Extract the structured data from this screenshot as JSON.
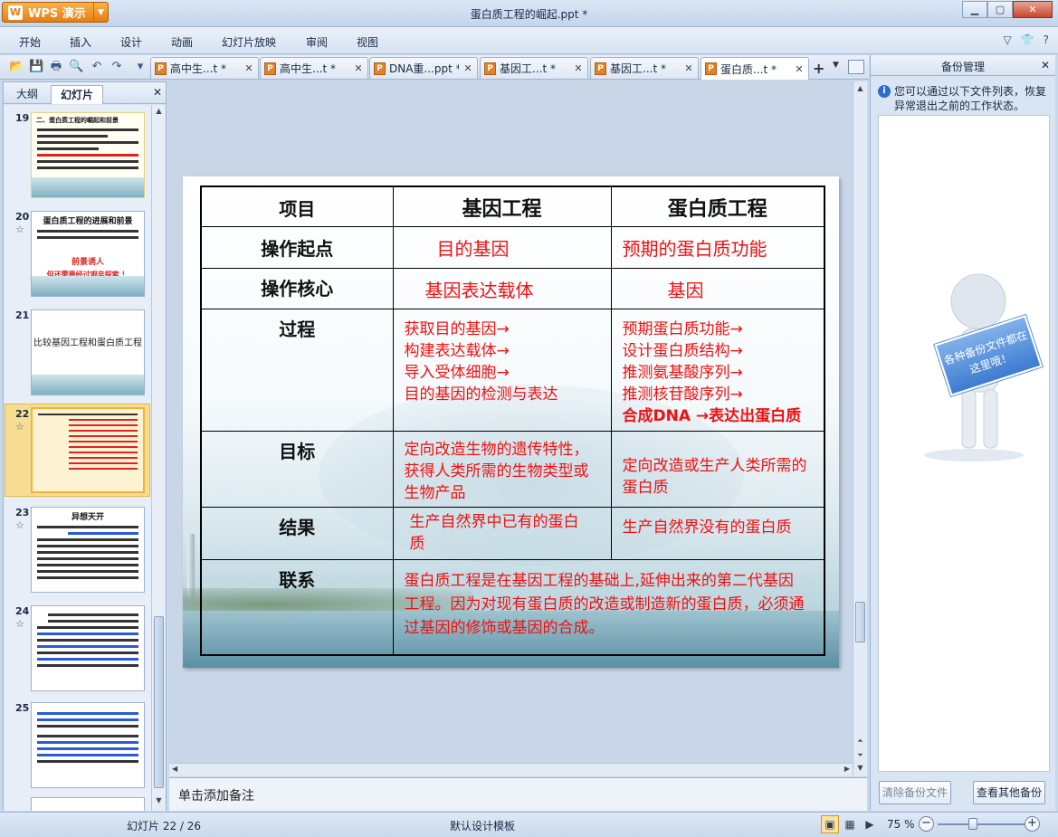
{
  "app": {
    "name": "WPS 演示",
    "logo": "W"
  },
  "window": {
    "title": "蛋白质工程的崛起.ppt *"
  },
  "menu": [
    "开始",
    "插入",
    "设计",
    "动画",
    "幻灯片放映",
    "审阅",
    "视图"
  ],
  "doc_tabs": [
    {
      "label": "高中生...t *",
      "active": false
    },
    {
      "label": "高中生...t *",
      "active": false
    },
    {
      "label": "DNA重...ppt *",
      "active": false
    },
    {
      "label": "基因工...t *",
      "active": false
    },
    {
      "label": "基因工...t *",
      "active": false
    },
    {
      "label": "蛋白质...t *",
      "active": true
    }
  ],
  "left_panel": {
    "tabs": [
      "大纲",
      "幻灯片"
    ],
    "active_tab": "幻灯片",
    "thumbnails": [
      {
        "number": "19",
        "title": "二、蛋白质工程的崛起和前景",
        "starred": false
      },
      {
        "number": "20",
        "title": "蛋白质工程的进展和前景",
        "subtitle": "前景诱人",
        "warning": "但还需要经过艰辛探索 ！",
        "starred": true
      },
      {
        "number": "21",
        "title": "比较基因工程和蛋白质工程",
        "starred": false
      },
      {
        "number": "22",
        "title": "",
        "starred": true,
        "selected": true
      },
      {
        "number": "23",
        "title": "异想天开",
        "starred": true
      },
      {
        "number": "24",
        "title": "",
        "starred": true
      },
      {
        "number": "25",
        "title": "",
        "starred": false
      }
    ]
  },
  "slide_table": {
    "headers": [
      "项目",
      "基因工程",
      "蛋白质工程"
    ],
    "rows": [
      {
        "label": "操作起点",
        "gene": "目的基因",
        "protein": "预期的蛋白质功能"
      },
      {
        "label": "操作核心",
        "gene": "基因表达载体",
        "protein": "基因"
      },
      {
        "label": "过程",
        "gene_lines": [
          "获取目的基因→",
          "构建表达载体→",
          "导入受体细胞→",
          "目的基因的检测与表达"
        ],
        "protein_lines": [
          "预期蛋白质功能→",
          "设计蛋白质结构→",
          "推测氨基酸序列→",
          "推测核苷酸序列→",
          "合成DNA →表达出蛋白质"
        ]
      },
      {
        "label": "目标",
        "gene": "定向改造生物的遗传特性，获得人类所需的生物类型或生物产品",
        "protein": "定向改造或生产人类所需的蛋白质"
      },
      {
        "label": "结果",
        "gene": "生产自然界中已有的蛋白质",
        "protein": "生产自然界没有的蛋白质"
      },
      {
        "label": "联系",
        "merged": "蛋白质工程是在基因工程的基础上,延伸出来的第二代基因工程。因为对现有蛋白质的改造或制造新的蛋白质，必须通过基因的修饰或基因的合成。"
      }
    ]
  },
  "notes_placeholder": "单击添加备注",
  "right_panel": {
    "title": "备份管理",
    "info": "您可以通过以下文件列表，恢复异常退出之前的工作状态。",
    "sign_text": "各种备份文件都在这里哦！",
    "clear_button": "清除备份文件",
    "view_button": "查看其他备份"
  },
  "status": {
    "slide_counter": "幻灯片 22 / 26",
    "template": "默认设计模板",
    "zoom": "75 %",
    "zoom_fraction": 0.4
  },
  "colors": {
    "accent": "#e67e12",
    "table_red": "#e11111"
  }
}
